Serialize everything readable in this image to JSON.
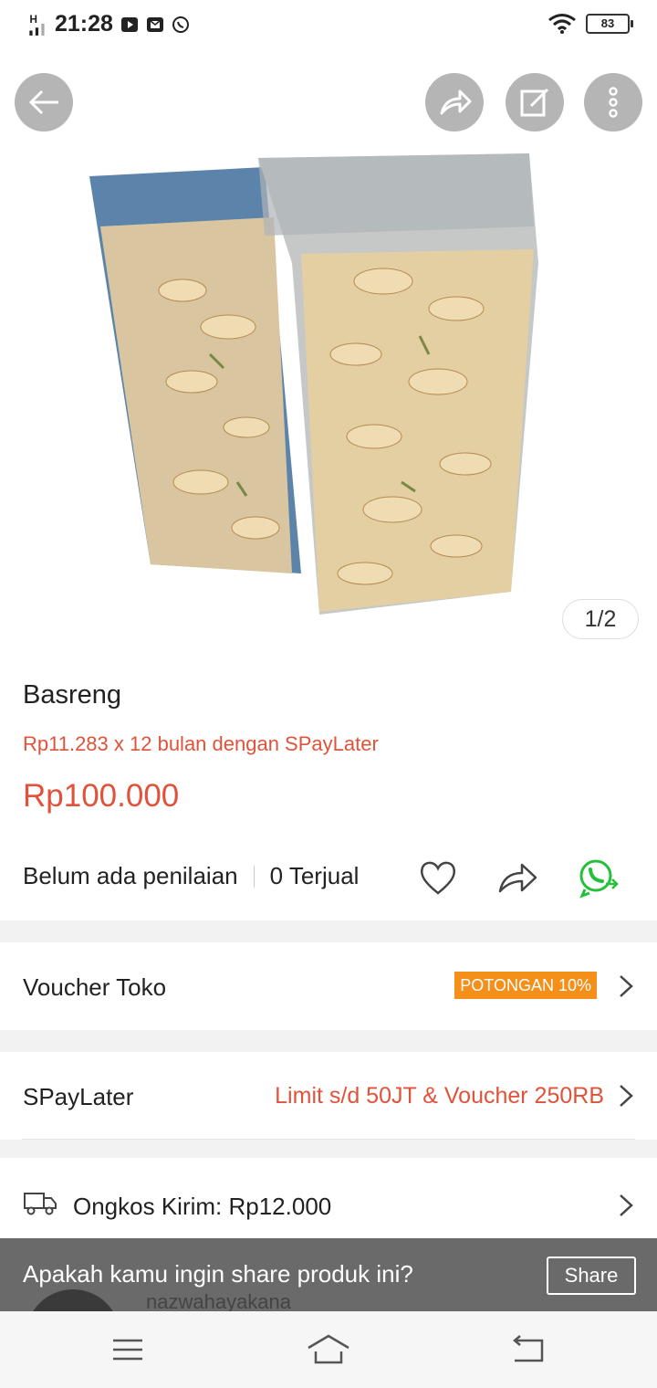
{
  "status": {
    "time": "21:28",
    "network": "H",
    "battery": "83"
  },
  "image": {
    "counter": "1/2"
  },
  "product": {
    "name": "Basreng",
    "installment": "Rp11.283 x 12 bulan dengan SPayLater",
    "price": "Rp100.000",
    "rating": "Belum ada penilaian",
    "sold": "0 Terjual"
  },
  "voucher": {
    "label": "Voucher Toko",
    "badge": "POTONGAN 10%"
  },
  "spaylater": {
    "label": "SPayLater",
    "promo": "Limit s/d 50JT & Voucher 250RB"
  },
  "shipping": {
    "label": "Ongkos Kirim: Rp12.000"
  },
  "toast": {
    "message": "Apakah kamu ingin share produk ini?",
    "button": "Share"
  },
  "seller": {
    "name_partial": "nazwahayakana"
  },
  "colors": {
    "accent": "#e0533a",
    "badge": "#f48f1a",
    "whatsapp": "#25c03a"
  },
  "icons": [
    "back-icon",
    "share-icon",
    "edit-icon",
    "more-icon",
    "heart-icon",
    "share-arrow-icon",
    "whatsapp-icon",
    "truck-icon",
    "chevron-right-icon",
    "menu-icon",
    "home-icon",
    "back-nav-icon"
  ]
}
